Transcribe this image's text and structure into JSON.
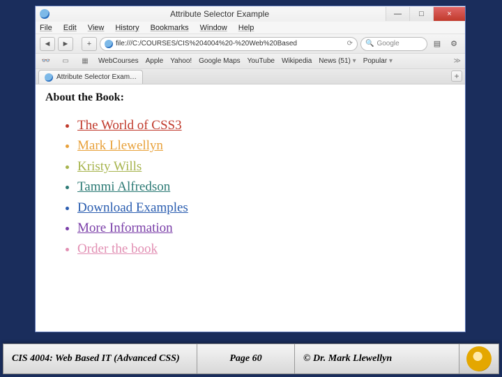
{
  "window": {
    "title": "Attribute Selector Example",
    "minimize_glyph": "—",
    "restore_glyph": "□",
    "close_glyph": "×"
  },
  "menubar": {
    "items": [
      "File",
      "Edit",
      "View",
      "History",
      "Bookmarks",
      "Window",
      "Help"
    ]
  },
  "navbar": {
    "back_glyph": "◄",
    "forward_glyph": "►",
    "add_glyph": "+",
    "url": "file:///C:/COURSES/CIS%204004%20-%20Web%20Based",
    "reload_glyph": "⟳",
    "search_placeholder": "Google",
    "search_icon": "🔍",
    "page_icon": "▤",
    "gear_icon": "⚙"
  },
  "bookmarks": {
    "icons": {
      "glasses": "👓",
      "book": "▭",
      "grid": "▦"
    },
    "items": [
      "WebCourses",
      "Apple",
      "Yahoo!",
      "Google Maps",
      "YouTube",
      "Wikipedia"
    ],
    "news_label": "News (51)",
    "popular_label": "Popular",
    "chev": "▾",
    "overflow": "≫"
  },
  "tab": {
    "label": "Attribute Selector Exam…",
    "add_glyph": "+"
  },
  "page": {
    "heading": "About the Book:",
    "links": [
      {
        "text": "The World of CSS3",
        "cls": "c-red"
      },
      {
        "text": "Mark Llewellyn",
        "cls": "c-orange"
      },
      {
        "text": "Kristy Wills",
        "cls": "c-olive"
      },
      {
        "text": "Tammi Alfredson",
        "cls": "c-teal"
      },
      {
        "text": "Download Examples",
        "cls": "c-blue"
      },
      {
        "text": "More Information",
        "cls": "c-purple"
      },
      {
        "text": "Order the book",
        "cls": "c-pink"
      }
    ]
  },
  "footer": {
    "course": "CIS 4004: Web Based IT (Advanced CSS)",
    "page": "Page 60",
    "author": "© Dr. Mark Llewellyn"
  }
}
